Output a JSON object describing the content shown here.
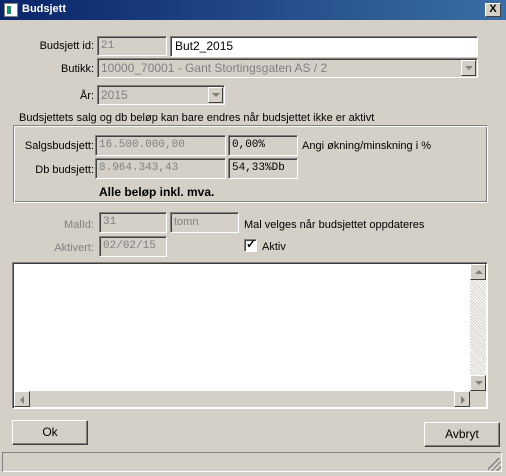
{
  "window": {
    "title": "Budsjett",
    "close_label": "X"
  },
  "form": {
    "budsjett_id": {
      "label": "Budsjett id:",
      "id_value": "21",
      "name_value": "But2_2015"
    },
    "butikk": {
      "label": "Butikk:",
      "value": "10000_70001 - Gant Stortingsgaten AS / 2"
    },
    "aar": {
      "label": "År:",
      "value": "2015"
    },
    "notice": "Budsjettets salg og db beløp kan bare endres når budsjettet ikke er aktivt"
  },
  "group": {
    "salgsbudsjett": {
      "label": "Salgsbudsjett:",
      "amount": "16.500.000,00",
      "percent": "0,00%",
      "hint": "Angi økning/minskning i %"
    },
    "db_budsjett": {
      "label": "Db budsjett:",
      "amount": "8.964.343,43",
      "percent": "54,33%Db"
    },
    "footer_note": "Alle beløp inkl. mva."
  },
  "mal": {
    "label": "MalId:",
    "id_value": "31",
    "name_value": "tomn",
    "hint": "Mal velges når budsjettet oppdateres"
  },
  "aktivert": {
    "label": "Aktivert:",
    "date": "02/02/15",
    "checkbox_label": "Aktiv",
    "checked": true
  },
  "buttons": {
    "ok": "Ok",
    "avbryt": "Avbryt"
  }
}
